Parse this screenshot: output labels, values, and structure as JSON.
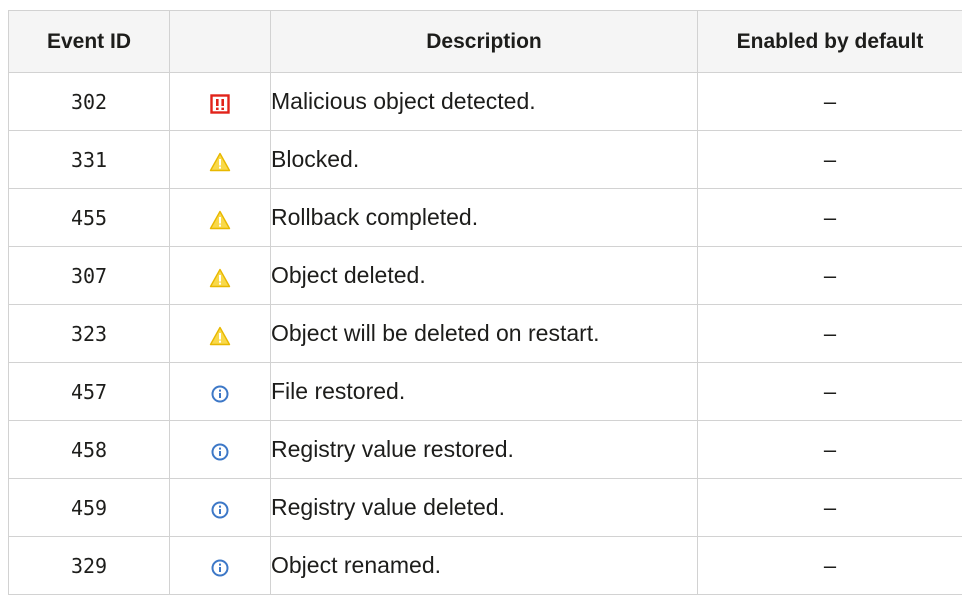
{
  "columns": {
    "event_id": "Event ID",
    "icon": "",
    "description": "Description",
    "enabled_by_default": "Enabled by default"
  },
  "rows": [
    {
      "event_id": "302",
      "severity_icon": "error-icon",
      "description": "Malicious object detected.",
      "enabled": "–"
    },
    {
      "event_id": "331",
      "severity_icon": "warning-icon",
      "description": "Blocked.",
      "enabled": "–"
    },
    {
      "event_id": "455",
      "severity_icon": "warning-icon",
      "description": "Rollback completed.",
      "enabled": "–"
    },
    {
      "event_id": "307",
      "severity_icon": "warning-icon",
      "description": "Object deleted.",
      "enabled": "–"
    },
    {
      "event_id": "323",
      "severity_icon": "warning-icon",
      "description": "Object will be deleted on restart.",
      "enabled": "–"
    },
    {
      "event_id": "457",
      "severity_icon": "info-icon",
      "description": "File restored.",
      "enabled": "–"
    },
    {
      "event_id": "458",
      "severity_icon": "info-icon",
      "description": "Registry value restored.",
      "enabled": "–"
    },
    {
      "event_id": "459",
      "severity_icon": "info-icon",
      "description": "Registry value deleted.",
      "enabled": "–"
    },
    {
      "event_id": "329",
      "severity_icon": "info-icon",
      "description": "Object renamed.",
      "enabled": "–"
    }
  ],
  "colors": {
    "header_bg": "#f5f5f5",
    "border": "#d2d2d2",
    "error": "#e2231a",
    "warning_fill": "#f9d94a",
    "warning_stroke": "#e8b800",
    "info": "#3d78c7"
  }
}
